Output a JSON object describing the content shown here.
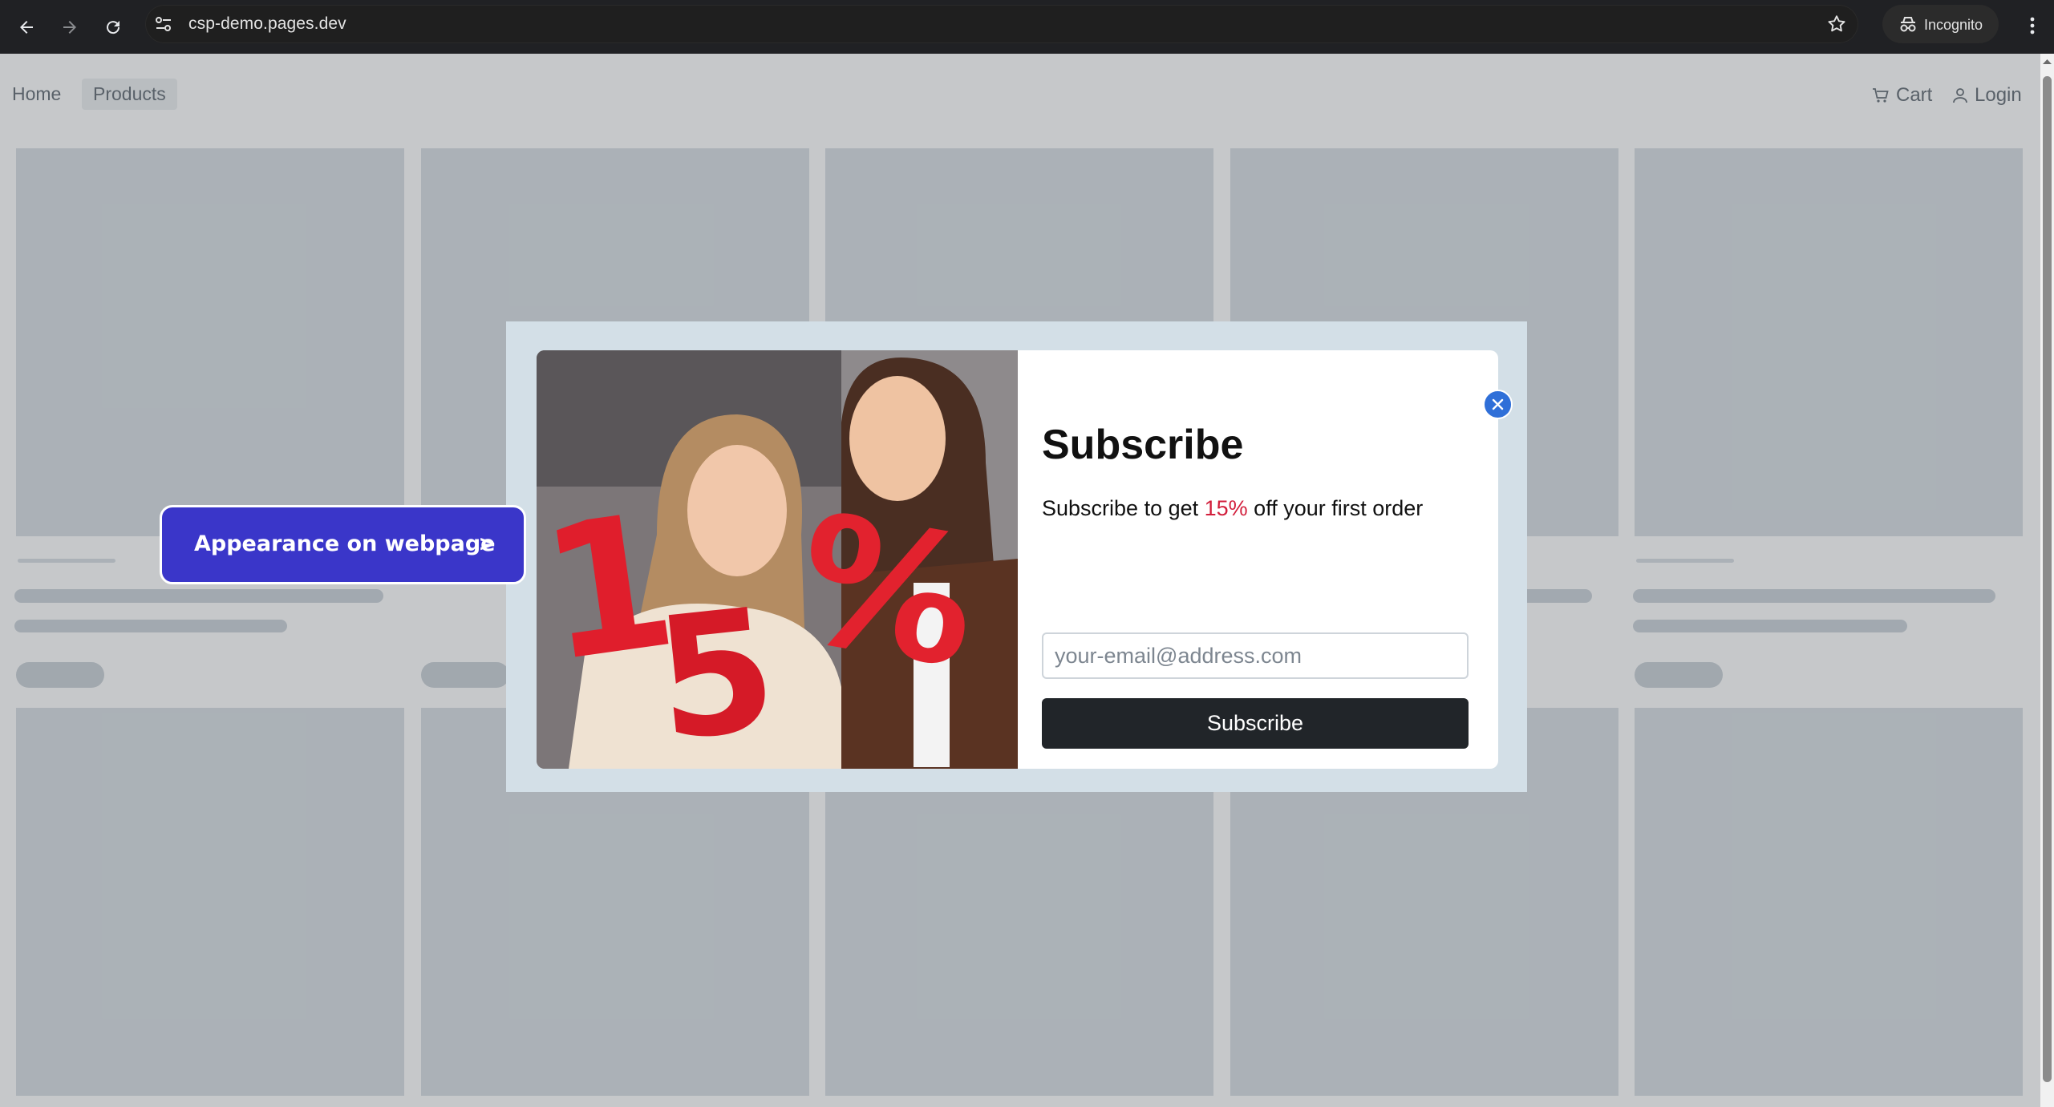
{
  "browser": {
    "url": "csp-demo.pages.dev",
    "profile_label": "Incognito"
  },
  "site_nav": {
    "home": "Home",
    "products": "Products",
    "cart": "Cart",
    "login": "Login"
  },
  "callout": {
    "label": "Appearance on webpage",
    "arrow": ">"
  },
  "modal": {
    "title": "Subscribe",
    "subtitle_before": "Subscribe to get ",
    "subtitle_accent": "15%",
    "subtitle_after": " off your first order",
    "email_placeholder": "your-email@address.com",
    "button_label": "Subscribe",
    "promo_digits": "15%",
    "accent_color": "#d21f3c"
  }
}
